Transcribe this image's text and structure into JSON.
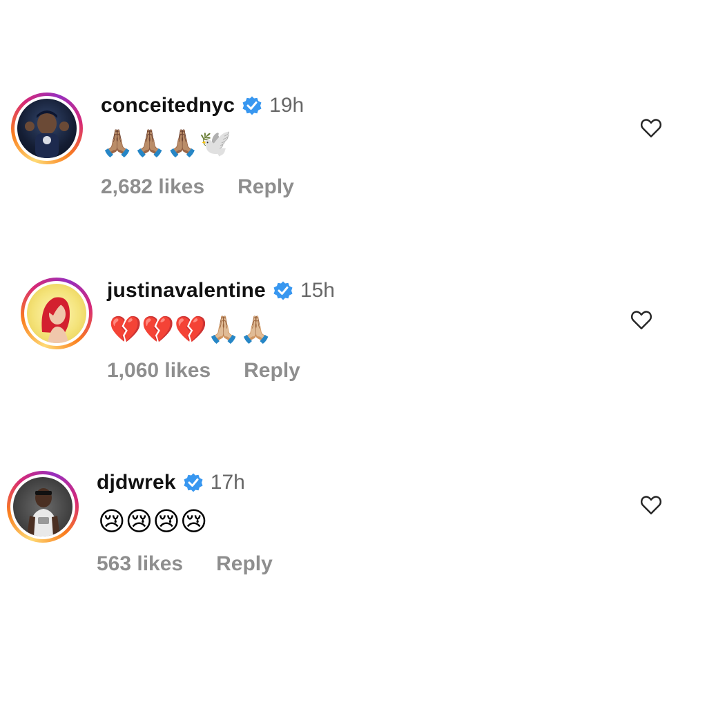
{
  "comments": [
    {
      "username": "conceitednyc",
      "time": "19h",
      "emoji_text": "🙏🏽🙏🏽🙏🏽🕊️",
      "likes": "2,682 likes",
      "reply": "Reply",
      "verified": true
    },
    {
      "username": "justinavalentine",
      "time": "15h",
      "emoji_text": "💔💔💔🙏🏼🙏🏼",
      "likes": "1,060 likes",
      "reply": "Reply",
      "verified": true
    },
    {
      "username": "djdwrek",
      "time": "17h",
      "emoji_text": "😢😢😢😢",
      "likes": "563 likes",
      "reply": "Reply",
      "verified": true
    }
  ],
  "colors": {
    "verified_blue": "#3897f0",
    "meta_gray": "#8e8e8e",
    "time_gray": "#666666"
  },
  "icons": {
    "verified": "verified-badge-icon",
    "like": "heart-outline-icon"
  }
}
